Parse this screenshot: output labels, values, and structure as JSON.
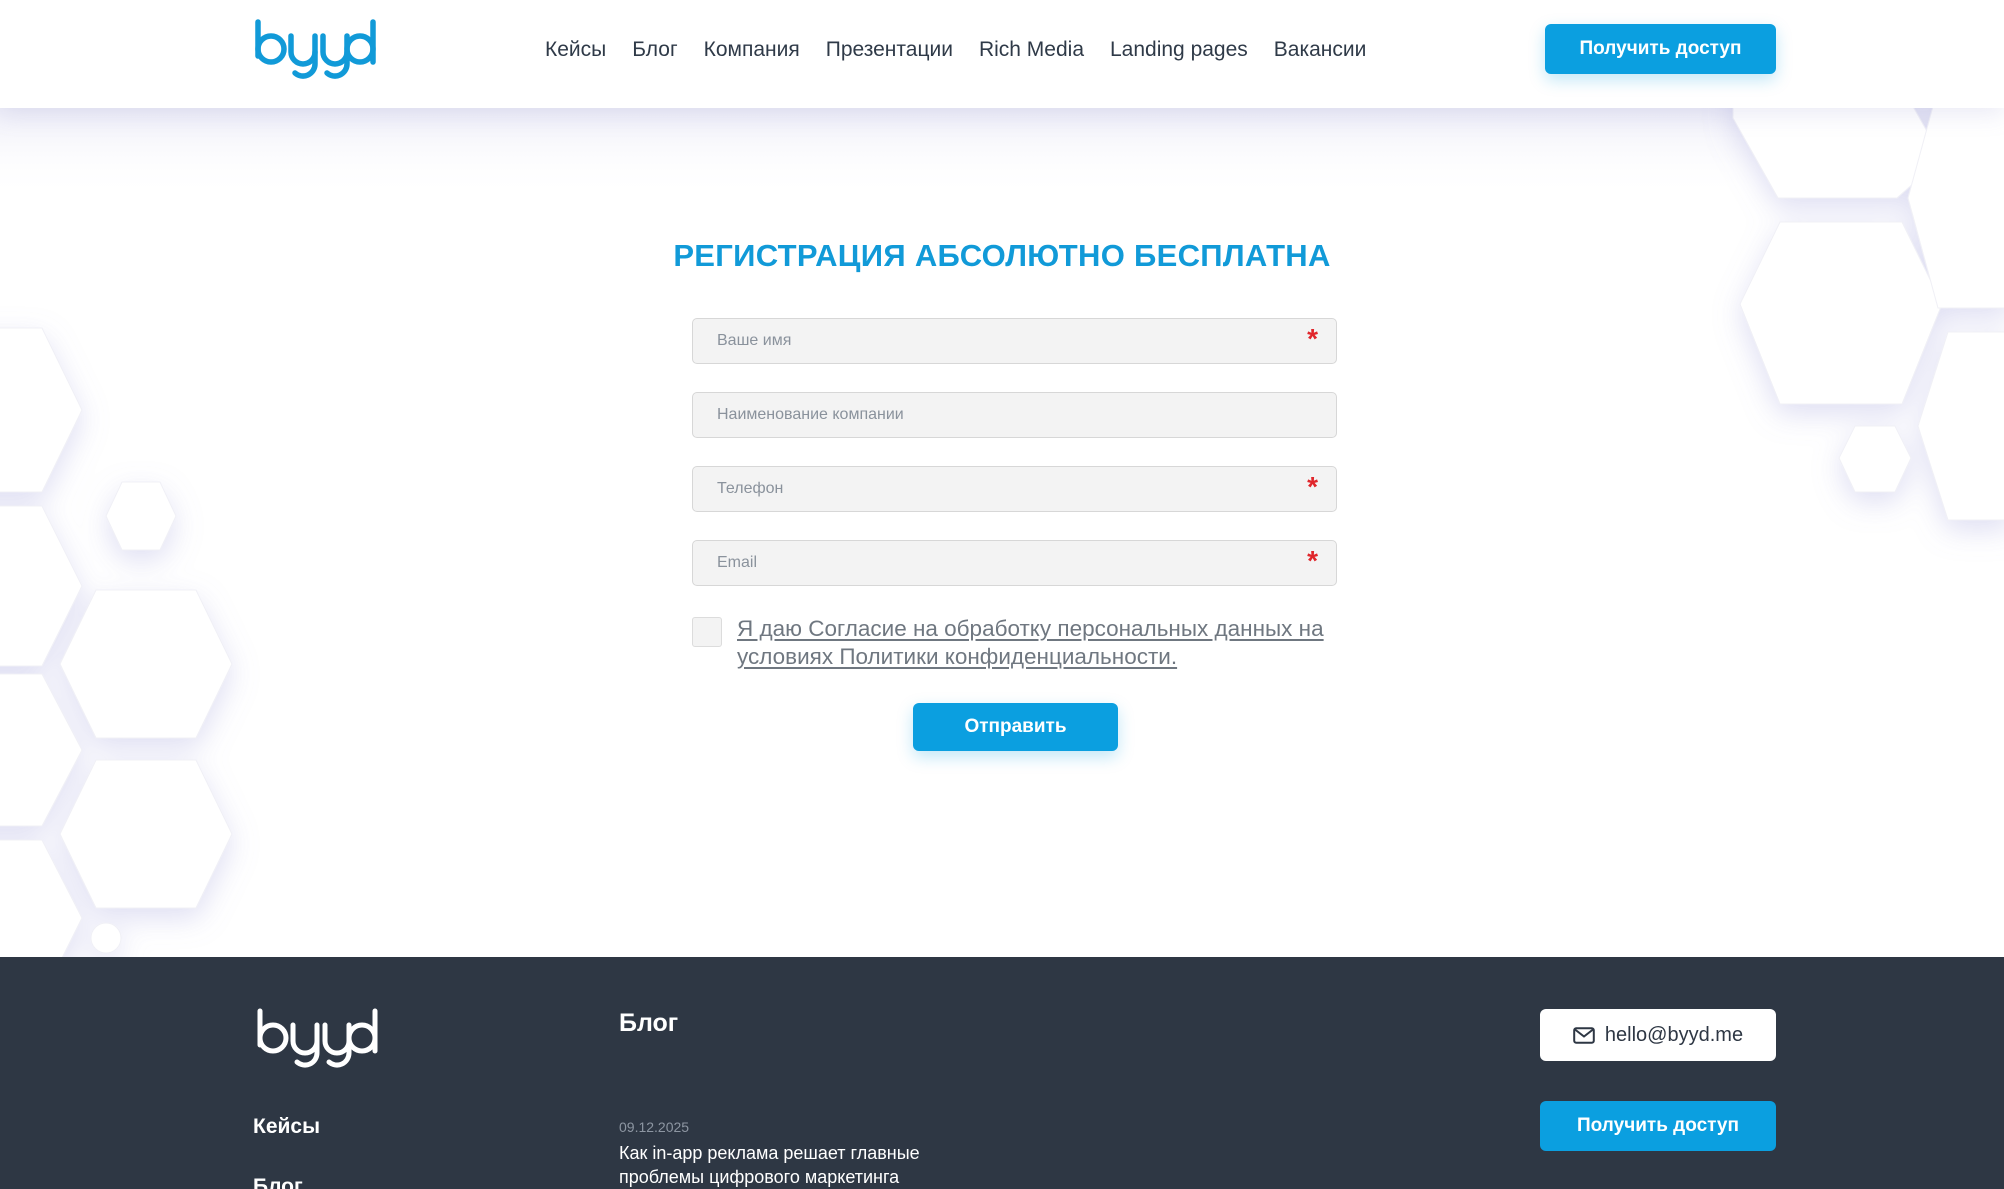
{
  "header": {
    "logo_text": "byyd",
    "nav": [
      "Кейсы",
      "Блог",
      "Компания",
      "Презентации",
      "Rich Media",
      "Landing pages",
      "Вакансии"
    ],
    "cta_label": "Получить доступ"
  },
  "form": {
    "title": "РЕГИСТРАЦИЯ АБСОЛЮТНО БЕСПЛАТНА",
    "fields": [
      {
        "placeholder": "Ваше имя",
        "required_mark": "*"
      },
      {
        "placeholder": "Наименование компании"
      },
      {
        "placeholder": "Телефон",
        "required_mark": "*"
      },
      {
        "placeholder": "Email",
        "required_mark": "*"
      }
    ],
    "consent": "Я даю Согласие на обработку персональных данных на условиях Политики конфиденциальности.",
    "submit_label": "Отправить"
  },
  "footer": {
    "logo_text": "byyd",
    "links": [
      "Кейсы",
      "Блог"
    ],
    "blog_title": "Блог",
    "post": {
      "date": "09.12.2025",
      "title": "Как in-app реклама решает главные проблемы цифрового маркетинга"
    },
    "email": "hello@byyd.me",
    "cta_label": "Получить доступ"
  },
  "colors": {
    "accent": "#0b9fe0",
    "title": "#119ad8",
    "required": "#e0262b",
    "footer_bg": "#2e3744"
  },
  "icons": [
    "mail-icon"
  ]
}
